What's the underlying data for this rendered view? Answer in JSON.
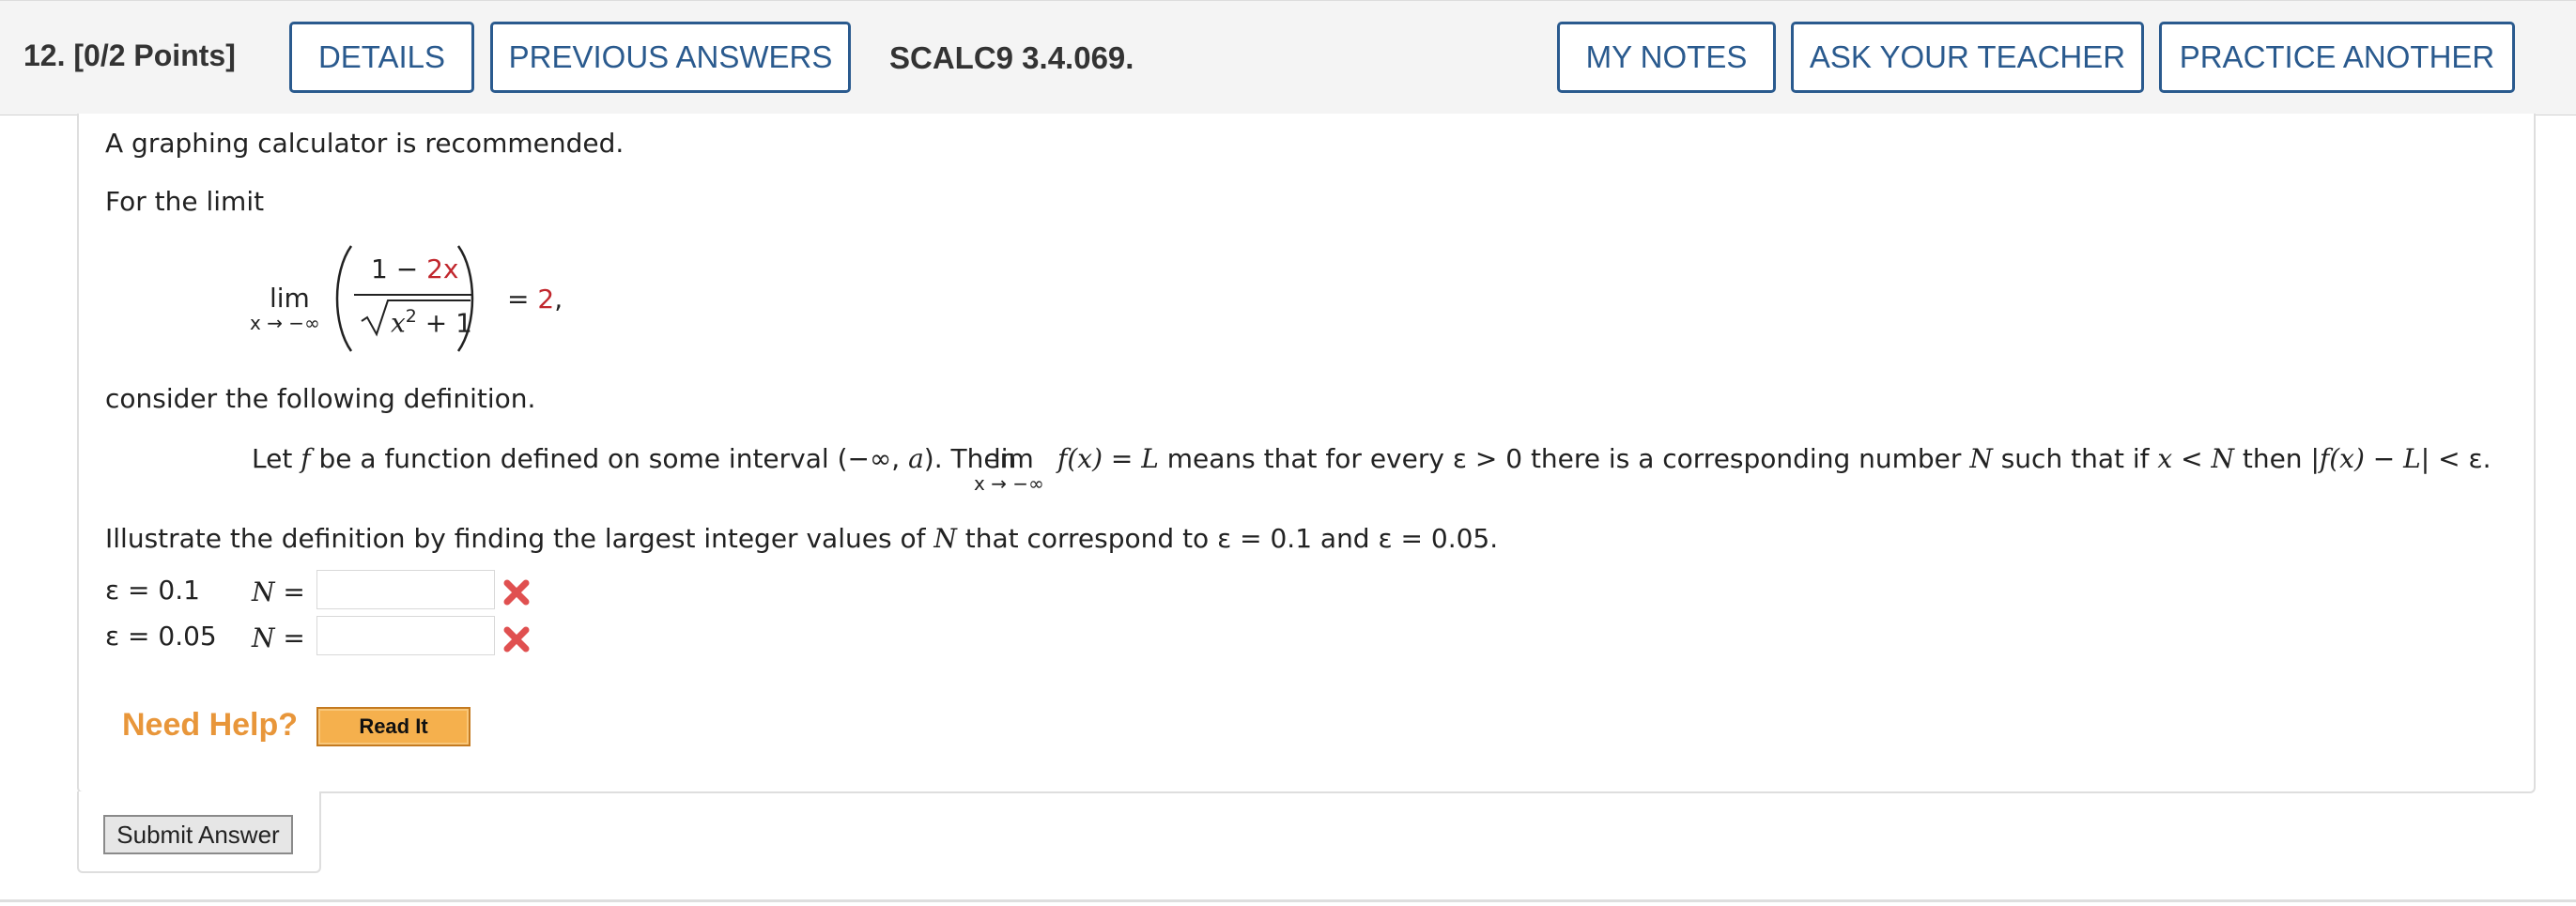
{
  "header": {
    "question_number": "12.",
    "points": "[0/2 Points]",
    "details_label": "DETAILS",
    "previous_answers_label": "PREVIOUS ANSWERS",
    "question_code": "SCALC9 3.4.069.",
    "my_notes_label": "MY NOTES",
    "ask_teacher_label": "ASK YOUR TEACHER",
    "practice_another_label": "PRACTICE ANOTHER"
  },
  "problem": {
    "intro": "A graphing calculator is recommended.",
    "for_the_limit": "For the limit",
    "limit": {
      "lim": "lim",
      "subscript": "x → −∞",
      "numerator_prefix": "1 − ",
      "numerator_term": "2x",
      "denominator_base": "x",
      "denominator_exponent": "2",
      "denominator_suffix": " + 1",
      "equals": "=",
      "value": "2",
      "trailing": ","
    },
    "consider": "consider the following definition.",
    "definition": {
      "part1": "Let ",
      "f": "f",
      "part2": " be a function defined on some interval (−∞, ",
      "a": "a",
      "part3": "). Then",
      "lim": "lim",
      "subscript": "x → −∞",
      "fx": "f(x)",
      "part4": " = ",
      "L": "L",
      "part5": " means that for every ε > 0 there is a corresponding number ",
      "N": "N",
      "part6": " such that if ",
      "x": "x",
      "part7": " < ",
      "N2": "N",
      "part8": " then |",
      "fx2": "f(x)",
      "part9": " − ",
      "L2": "L",
      "part10": "| < ε."
    },
    "instruction_part1": "Illustrate the definition by finding the largest integer values of ",
    "instruction_N": "N",
    "instruction_part2": " that correspond to ε = 0.1 and ε = 0.05."
  },
  "answers": [
    {
      "epsilon_label": "ε = 0.1",
      "n_label": "N",
      "equals": "=",
      "value": "",
      "status": "incorrect"
    },
    {
      "epsilon_label": "ε = 0.05",
      "n_label": "N",
      "equals": "=",
      "value": "",
      "status": "incorrect"
    }
  ],
  "help": {
    "need_help_label": "Need Help?",
    "read_it_label": "Read It"
  },
  "submit_label": "Submit Answer",
  "colors": {
    "brand_blue": "#2a5a8e",
    "answer_red": "#c1272d",
    "incorrect_x": "#e05050",
    "help_orange": "#e8963a",
    "read_it_bg": "#f5b04d"
  },
  "icons": {
    "incorrect": "x-mark-icon"
  }
}
